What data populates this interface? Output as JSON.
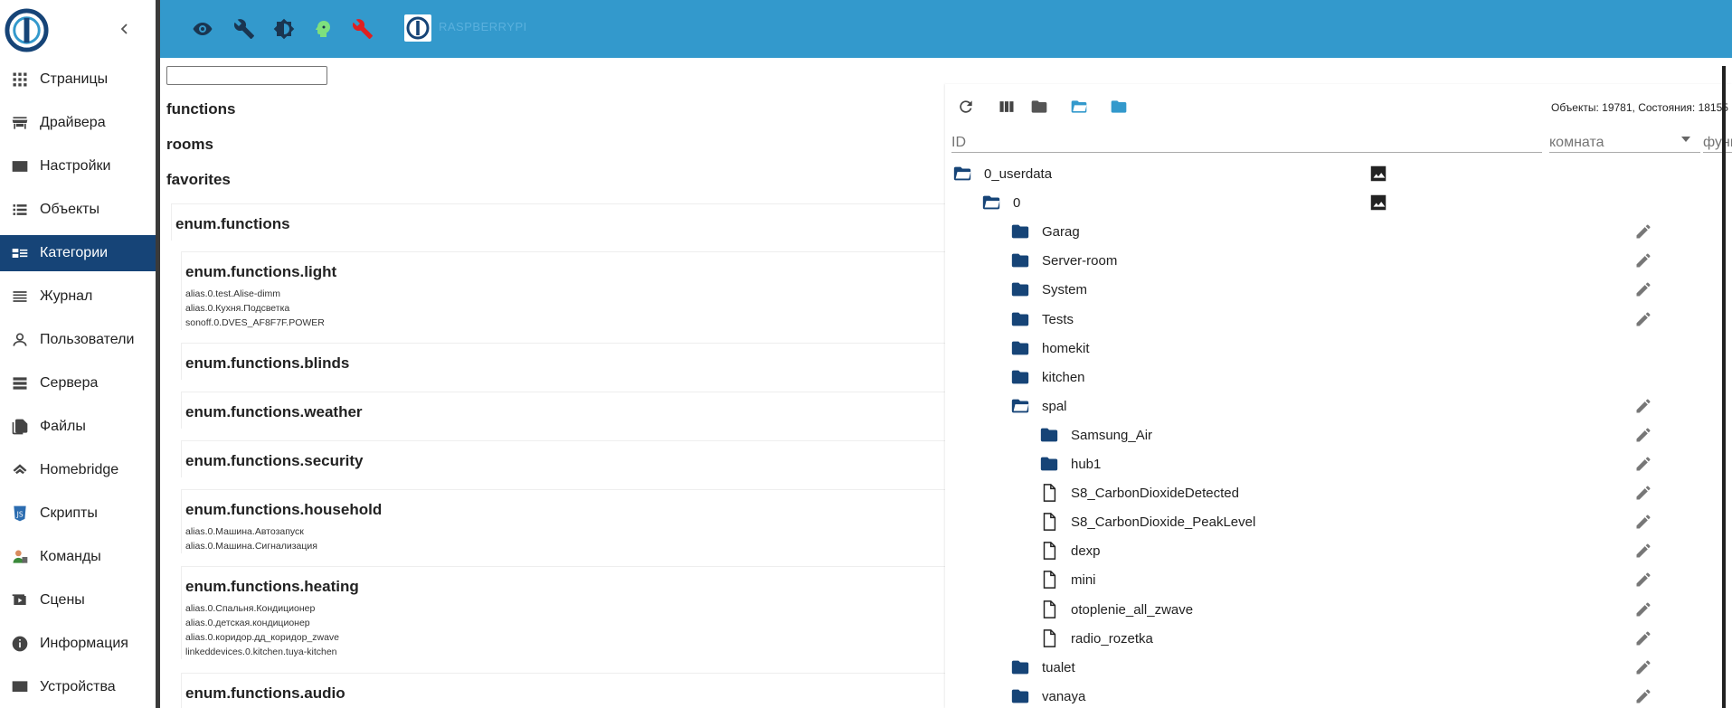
{
  "sidebar": {
    "items": [
      {
        "label": "Страницы",
        "icon": "grid-icon"
      },
      {
        "label": "Драйвера",
        "icon": "store-icon"
      },
      {
        "label": "Настройки",
        "icon": "card-icon"
      },
      {
        "label": "Объекты",
        "icon": "list-icon"
      },
      {
        "label": "Категории",
        "icon": "category-icon"
      },
      {
        "label": "Журнал",
        "icon": "log-icon"
      },
      {
        "label": "Пользователи",
        "icon": "user-icon"
      },
      {
        "label": "Сервера",
        "icon": "server-icon"
      },
      {
        "label": "Файлы",
        "icon": "files-icon"
      },
      {
        "label": "Homebridge",
        "icon": "homebridge-icon"
      },
      {
        "label": "Скрипты",
        "icon": "js-icon"
      },
      {
        "label": "Команды",
        "icon": "commands-icon"
      },
      {
        "label": "Сцены",
        "icon": "scenes-icon"
      },
      {
        "label": "Информация",
        "icon": "info-icon"
      },
      {
        "label": "Устройства",
        "icon": "devices-icon"
      }
    ],
    "active_index": 4
  },
  "topbar": {
    "hostname": "RASPBERRYPI"
  },
  "categories": {
    "search_value": "",
    "roots": [
      "functions",
      "rooms",
      "favorites"
    ],
    "enums": [
      {
        "title": "enum.functions",
        "members": []
      },
      {
        "title": "enum.functions.light",
        "members": [
          "alias.0.test.Alise-dimm",
          "alias.0.Кухня.Подсветка",
          "sonoff.0.DVES_AF8F7F.POWER"
        ]
      },
      {
        "title": "enum.functions.blinds",
        "members": []
      },
      {
        "title": "enum.functions.weather",
        "members": []
      },
      {
        "title": "enum.functions.security",
        "members": []
      },
      {
        "title": "enum.functions.household",
        "members": [
          "alias.0.Машина.Автозапуск",
          "alias.0.Машина.Сигнализация"
        ]
      },
      {
        "title": "enum.functions.heating",
        "members": [
          "alias.0.Спальня.Кондиционер",
          "alias.0.детская.кондиционер",
          "alias.0.коридор.дд_коридор_zwave",
          "linkeddevices.0.kitchen.tuya-kitchen"
        ]
      },
      {
        "title": "enum.functions.audio",
        "members": []
      }
    ]
  },
  "objects": {
    "stats": "Объекты: 19781, Состояния: 18155",
    "filter_id_placeholder": "ID",
    "filter_room_placeholder": "комната",
    "filter_func_placeholder": "функция",
    "tree": [
      {
        "label": "0_userdata",
        "type": "folder-open",
        "level": 0,
        "image": true,
        "edit": false
      },
      {
        "label": "0",
        "type": "folder-open",
        "level": 1,
        "image": true,
        "edit": false
      },
      {
        "label": "Garag",
        "type": "folder",
        "level": 2,
        "image": false,
        "edit": true
      },
      {
        "label": "Server-room",
        "type": "folder",
        "level": 2,
        "image": false,
        "edit": true
      },
      {
        "label": "System",
        "type": "folder",
        "level": 2,
        "image": false,
        "edit": true
      },
      {
        "label": "Tests",
        "type": "folder",
        "level": 2,
        "image": false,
        "edit": true
      },
      {
        "label": "homekit",
        "type": "folder",
        "level": 2,
        "image": false,
        "edit": false
      },
      {
        "label": "kitchen",
        "type": "folder",
        "level": 2,
        "image": false,
        "edit": false
      },
      {
        "label": "spal",
        "type": "folder-open",
        "level": 2,
        "image": false,
        "edit": true
      },
      {
        "label": "Samsung_Air",
        "type": "folder",
        "level": 3,
        "image": false,
        "edit": true
      },
      {
        "label": "hub1",
        "type": "folder",
        "level": 3,
        "image": false,
        "edit": true
      },
      {
        "label": "S8_CarbonDioxideDetected",
        "type": "file",
        "level": 3,
        "image": false,
        "edit": true
      },
      {
        "label": "S8_CarbonDioxide_PeakLevel",
        "type": "file",
        "level": 3,
        "image": false,
        "edit": true
      },
      {
        "label": "dexp",
        "type": "file",
        "level": 3,
        "image": false,
        "edit": true
      },
      {
        "label": "mini",
        "type": "file",
        "level": 3,
        "image": false,
        "edit": true
      },
      {
        "label": "otoplenie_all_zwave",
        "type": "file",
        "level": 3,
        "image": false,
        "edit": true
      },
      {
        "label": "radio_rozetka",
        "type": "file",
        "level": 3,
        "image": false,
        "edit": true
      },
      {
        "label": "tualet",
        "type": "folder",
        "level": 2,
        "image": false,
        "edit": true
      },
      {
        "label": "vanaya",
        "type": "folder",
        "level": 2,
        "image": false,
        "edit": true
      }
    ]
  },
  "colors": {
    "topbar": "#3399cc",
    "sidebar_active": "#164477",
    "folder": "#164477",
    "folder_open_btn": "#3399cc"
  }
}
